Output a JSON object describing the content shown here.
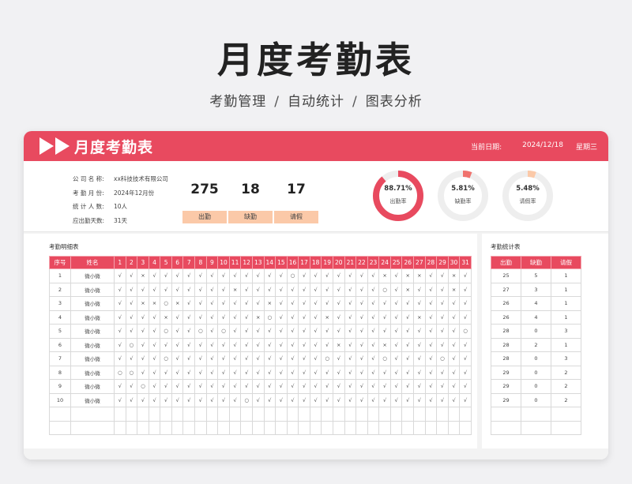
{
  "hero": {
    "title": "月度考勤表",
    "subtitle_items": [
      "考勤管理",
      "自动统计",
      "图表分析"
    ],
    "separator": "/"
  },
  "header": {
    "title": "月度考勤表",
    "date_label": "当前日期:",
    "date_value": "2024/12/18",
    "weekday": "星期三",
    "accent_color": "#e84a5f"
  },
  "info": [
    {
      "label": "公 司 名 称:",
      "value": "xx科技技术有限公司"
    },
    {
      "label": "考 勤 月 份:",
      "value": "2024年12月份"
    },
    {
      "label": "统 计 人 数:",
      "value": "10人"
    },
    {
      "label": "应出勤天数:",
      "value": "31天"
    }
  ],
  "stats": [
    {
      "value": "275",
      "label": "出勤"
    },
    {
      "value": "18",
      "label": "缺勤"
    },
    {
      "value": "17",
      "label": "请假"
    }
  ],
  "rings": [
    {
      "value": "88.71%",
      "label": "出勤率",
      "fraction": 0.8871,
      "color": "#e84a5f"
    },
    {
      "value": "5.81%",
      "label": "缺勤率",
      "fraction": 0.0581,
      "color": "#f0726d"
    },
    {
      "value": "5.48%",
      "label": "请假率",
      "fraction": 0.0548,
      "color": "#fbc9a8"
    }
  ],
  "detail": {
    "title": "考勤明细表",
    "col_index": "序号",
    "col_name": "姓名",
    "days": [
      "1",
      "2",
      "3",
      "4",
      "5",
      "6",
      "7",
      "8",
      "9",
      "10",
      "11",
      "12",
      "13",
      "14",
      "15",
      "16",
      "17",
      "18",
      "19",
      "20",
      "21",
      "22",
      "23",
      "24",
      "25",
      "26",
      "27",
      "28",
      "29",
      "30",
      "31"
    ],
    "rows": [
      {
        "index": "1",
        "name": "微小微",
        "marks": [
          "√",
          "√",
          "×",
          "√",
          "√",
          "√",
          "√",
          "√",
          "√",
          "√",
          "√",
          "√",
          "√",
          "√",
          "√",
          "○",
          "√",
          "√",
          "√",
          "√",
          "√",
          "√",
          "√",
          "×",
          "√",
          "×",
          "×",
          "√",
          "√",
          "×",
          "√"
        ]
      },
      {
        "index": "2",
        "name": "微小微",
        "marks": [
          "√",
          "√",
          "√",
          "√",
          "√",
          "√",
          "√",
          "√",
          "√",
          "√",
          "×",
          "√",
          "√",
          "√",
          "√",
          "√",
          "√",
          "√",
          "√",
          "√",
          "√",
          "√",
          "√",
          "○",
          "√",
          "×",
          "√",
          "√",
          "√",
          "×",
          "√"
        ]
      },
      {
        "index": "3",
        "name": "微小微",
        "marks": [
          "√",
          "√",
          "×",
          "×",
          "○",
          "×",
          "√",
          "√",
          "√",
          "√",
          "√",
          "√",
          "√",
          "×",
          "√",
          "√",
          "√",
          "√",
          "√",
          "√",
          "√",
          "√",
          "√",
          "√",
          "√",
          "√",
          "√",
          "√",
          "√",
          "√",
          "√"
        ]
      },
      {
        "index": "4",
        "name": "微小微",
        "marks": [
          "√",
          "√",
          "√",
          "√",
          "×",
          "√",
          "√",
          "√",
          "√",
          "√",
          "√",
          "√",
          "×",
          "○",
          "√",
          "√",
          "√",
          "√",
          "×",
          "√",
          "√",
          "√",
          "√",
          "√",
          "√",
          "√",
          "×",
          "√",
          "√",
          "√",
          "√"
        ]
      },
      {
        "index": "5",
        "name": "微小微",
        "marks": [
          "√",
          "√",
          "√",
          "√",
          "○",
          "√",
          "√",
          "○",
          "√",
          "○",
          "√",
          "√",
          "√",
          "√",
          "√",
          "√",
          "√",
          "√",
          "√",
          "√",
          "√",
          "√",
          "√",
          "√",
          "√",
          "√",
          "√",
          "√",
          "√",
          "√",
          "○"
        ]
      },
      {
        "index": "6",
        "name": "微小微",
        "marks": [
          "√",
          "○",
          "√",
          "√",
          "√",
          "√",
          "√",
          "√",
          "√",
          "√",
          "√",
          "√",
          "√",
          "√",
          "√",
          "√",
          "√",
          "√",
          "√",
          "×",
          "√",
          "√",
          "√",
          "×",
          "√",
          "√",
          "√",
          "√",
          "√",
          "√",
          "√"
        ]
      },
      {
        "index": "7",
        "name": "微小微",
        "marks": [
          "√",
          "√",
          "√",
          "√",
          "○",
          "√",
          "√",
          "√",
          "√",
          "√",
          "√",
          "√",
          "√",
          "√",
          "√",
          "√",
          "√",
          "√",
          "○",
          "√",
          "√",
          "√",
          "√",
          "○",
          "√",
          "√",
          "√",
          "√",
          "○",
          "√",
          "√"
        ]
      },
      {
        "index": "8",
        "name": "微小微",
        "marks": [
          "○",
          "○",
          "√",
          "√",
          "√",
          "√",
          "√",
          "√",
          "√",
          "√",
          "√",
          "√",
          "√",
          "√",
          "√",
          "√",
          "√",
          "√",
          "√",
          "√",
          "√",
          "√",
          "√",
          "√",
          "√",
          "√",
          "√",
          "√",
          "√",
          "√",
          "√"
        ]
      },
      {
        "index": "9",
        "name": "微小微",
        "marks": [
          "√",
          "√",
          "○",
          "√",
          "√",
          "√",
          "√",
          "√",
          "√",
          "√",
          "√",
          "√",
          "√",
          "√",
          "√",
          "√",
          "√",
          "√",
          "√",
          "√",
          "√",
          "√",
          "√",
          "√",
          "√",
          "√",
          "√",
          "√",
          "√",
          "√",
          "√"
        ]
      },
      {
        "index": "10",
        "name": "微小微",
        "marks": [
          "√",
          "√",
          "√",
          "√",
          "√",
          "√",
          "√",
          "√",
          "√",
          "√",
          "√",
          "○",
          "√",
          "√",
          "√",
          "√",
          "√",
          "√",
          "√",
          "√",
          "√",
          "√",
          "√",
          "√",
          "√",
          "√",
          "√",
          "√",
          "√",
          "√",
          "√"
        ]
      }
    ],
    "empty_rows": 2
  },
  "summary_table": {
    "title": "考勤统计表",
    "headers": [
      "出勤",
      "缺勤",
      "请假"
    ],
    "rows": [
      [
        "25",
        "5",
        "1"
      ],
      [
        "27",
        "3",
        "1"
      ],
      [
        "26",
        "4",
        "1"
      ],
      [
        "26",
        "4",
        "1"
      ],
      [
        "28",
        "0",
        "3"
      ],
      [
        "28",
        "2",
        "1"
      ],
      [
        "28",
        "0",
        "3"
      ],
      [
        "29",
        "0",
        "2"
      ],
      [
        "29",
        "0",
        "2"
      ],
      [
        "29",
        "0",
        "2"
      ]
    ],
    "empty_rows": 2
  }
}
